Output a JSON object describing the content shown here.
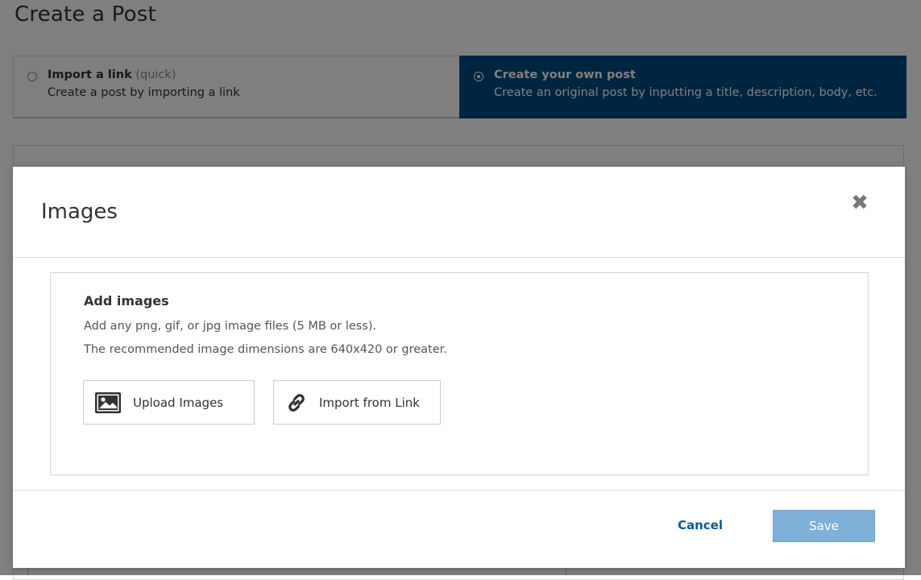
{
  "page": {
    "title": "Create a Post",
    "options": [
      {
        "title": "Import a link",
        "tag": "(quick)",
        "description": "Create a post by importing a link",
        "selected": false
      },
      {
        "title": "Create your own post",
        "description": "Create an original post by inputting a title, description, body, etc.",
        "selected": true
      }
    ]
  },
  "modal": {
    "title": "Images",
    "close_icon": "close-icon",
    "section_title": "Add images",
    "help_line1": "Add any png, gif, or jpg image files (5 MB or less).",
    "help_line2": "The recommended image dimensions are 640x420 or greater.",
    "upload_label": "Upload Images",
    "upload_icon": "image-icon",
    "import_label": "Import from Link",
    "import_icon": "link-icon",
    "cancel_label": "Cancel",
    "save_label": "Save"
  },
  "colors": {
    "selected_option_bg": "#004a80",
    "save_button_bg": "#7eb0d8",
    "cancel_text": "#0a5a9c"
  }
}
